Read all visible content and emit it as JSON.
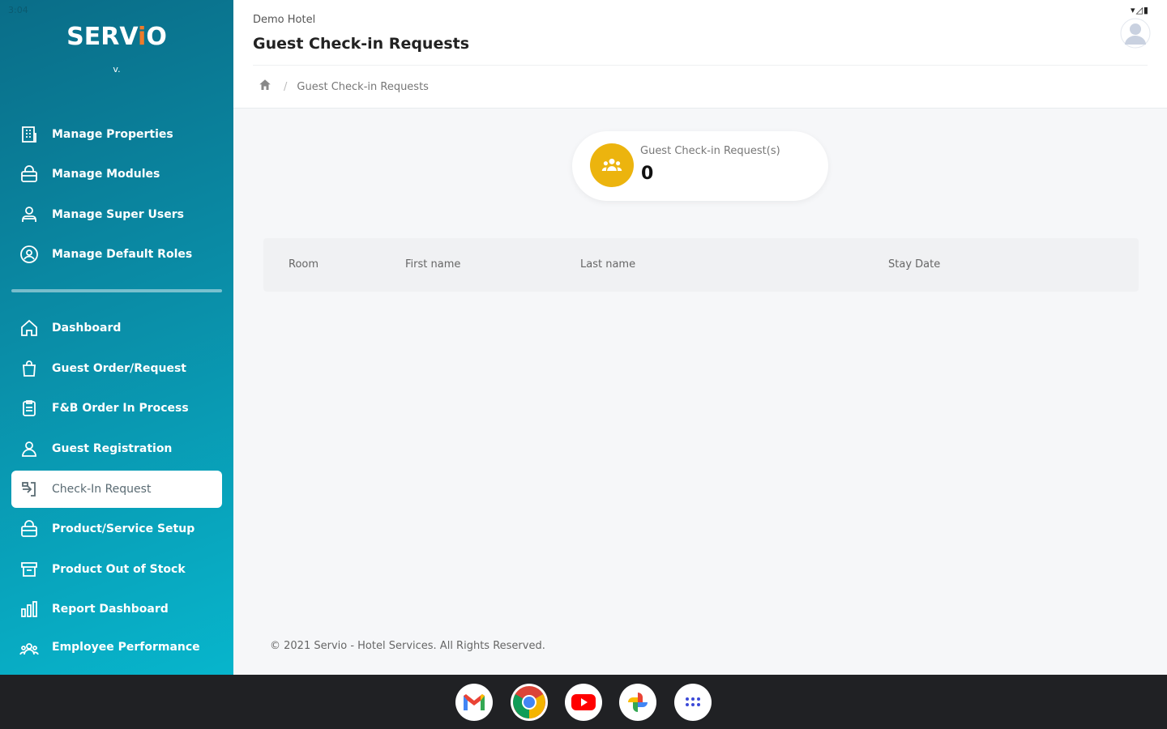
{
  "status_bar": {
    "time": "3:04",
    "icons": "▾◿▮"
  },
  "brand": {
    "prefix": "SERV",
    "accent": "i",
    "suffix": "O",
    "version": "v."
  },
  "sidebar": {
    "admin_items": [
      {
        "label": "Manage Properties",
        "icon": "building-icon"
      },
      {
        "label": "Manage Modules",
        "icon": "bag-icon"
      },
      {
        "label": "Manage Super Users",
        "icon": "users-icon"
      },
      {
        "label": "Manage Default Roles",
        "icon": "user-circle-icon"
      }
    ],
    "items": [
      {
        "label": "Dashboard",
        "icon": "home-icon"
      },
      {
        "label": "Guest Order/Request",
        "icon": "shopping-bag-icon"
      },
      {
        "label": "F&B Order In Process",
        "icon": "clipboard-icon"
      },
      {
        "label": "Guest Registration",
        "icon": "user-icon"
      },
      {
        "label": "Check-In Request",
        "icon": "sign-in-icon",
        "active": true
      },
      {
        "label": "Product/Service Setup",
        "icon": "bag-icon"
      },
      {
        "label": "Product Out of Stock",
        "icon": "archive-icon"
      },
      {
        "label": "Report Dashboard",
        "icon": "bar-chart-icon"
      },
      {
        "label": "Employee Performance",
        "icon": "team-icon"
      }
    ]
  },
  "header": {
    "hotel": "Demo Hotel",
    "title": "Guest Check-in Requests",
    "breadcrumb": {
      "home_icon": "home-icon",
      "current": "Guest Check-in Requests"
    }
  },
  "stat": {
    "label": "Guest Check-in Request(s)",
    "value": "0",
    "icon": "group-icon",
    "color": "#ecb40e"
  },
  "table": {
    "columns": [
      "Room",
      "First name",
      "Last name",
      "Stay Date"
    ],
    "rows": []
  },
  "footer": "© 2021 Servio - Hotel Services. All Rights Reserved.",
  "taskbar": {
    "apps": [
      "gmail-icon",
      "chrome-icon",
      "youtube-icon",
      "photos-icon",
      "app-launcher-icon"
    ]
  }
}
